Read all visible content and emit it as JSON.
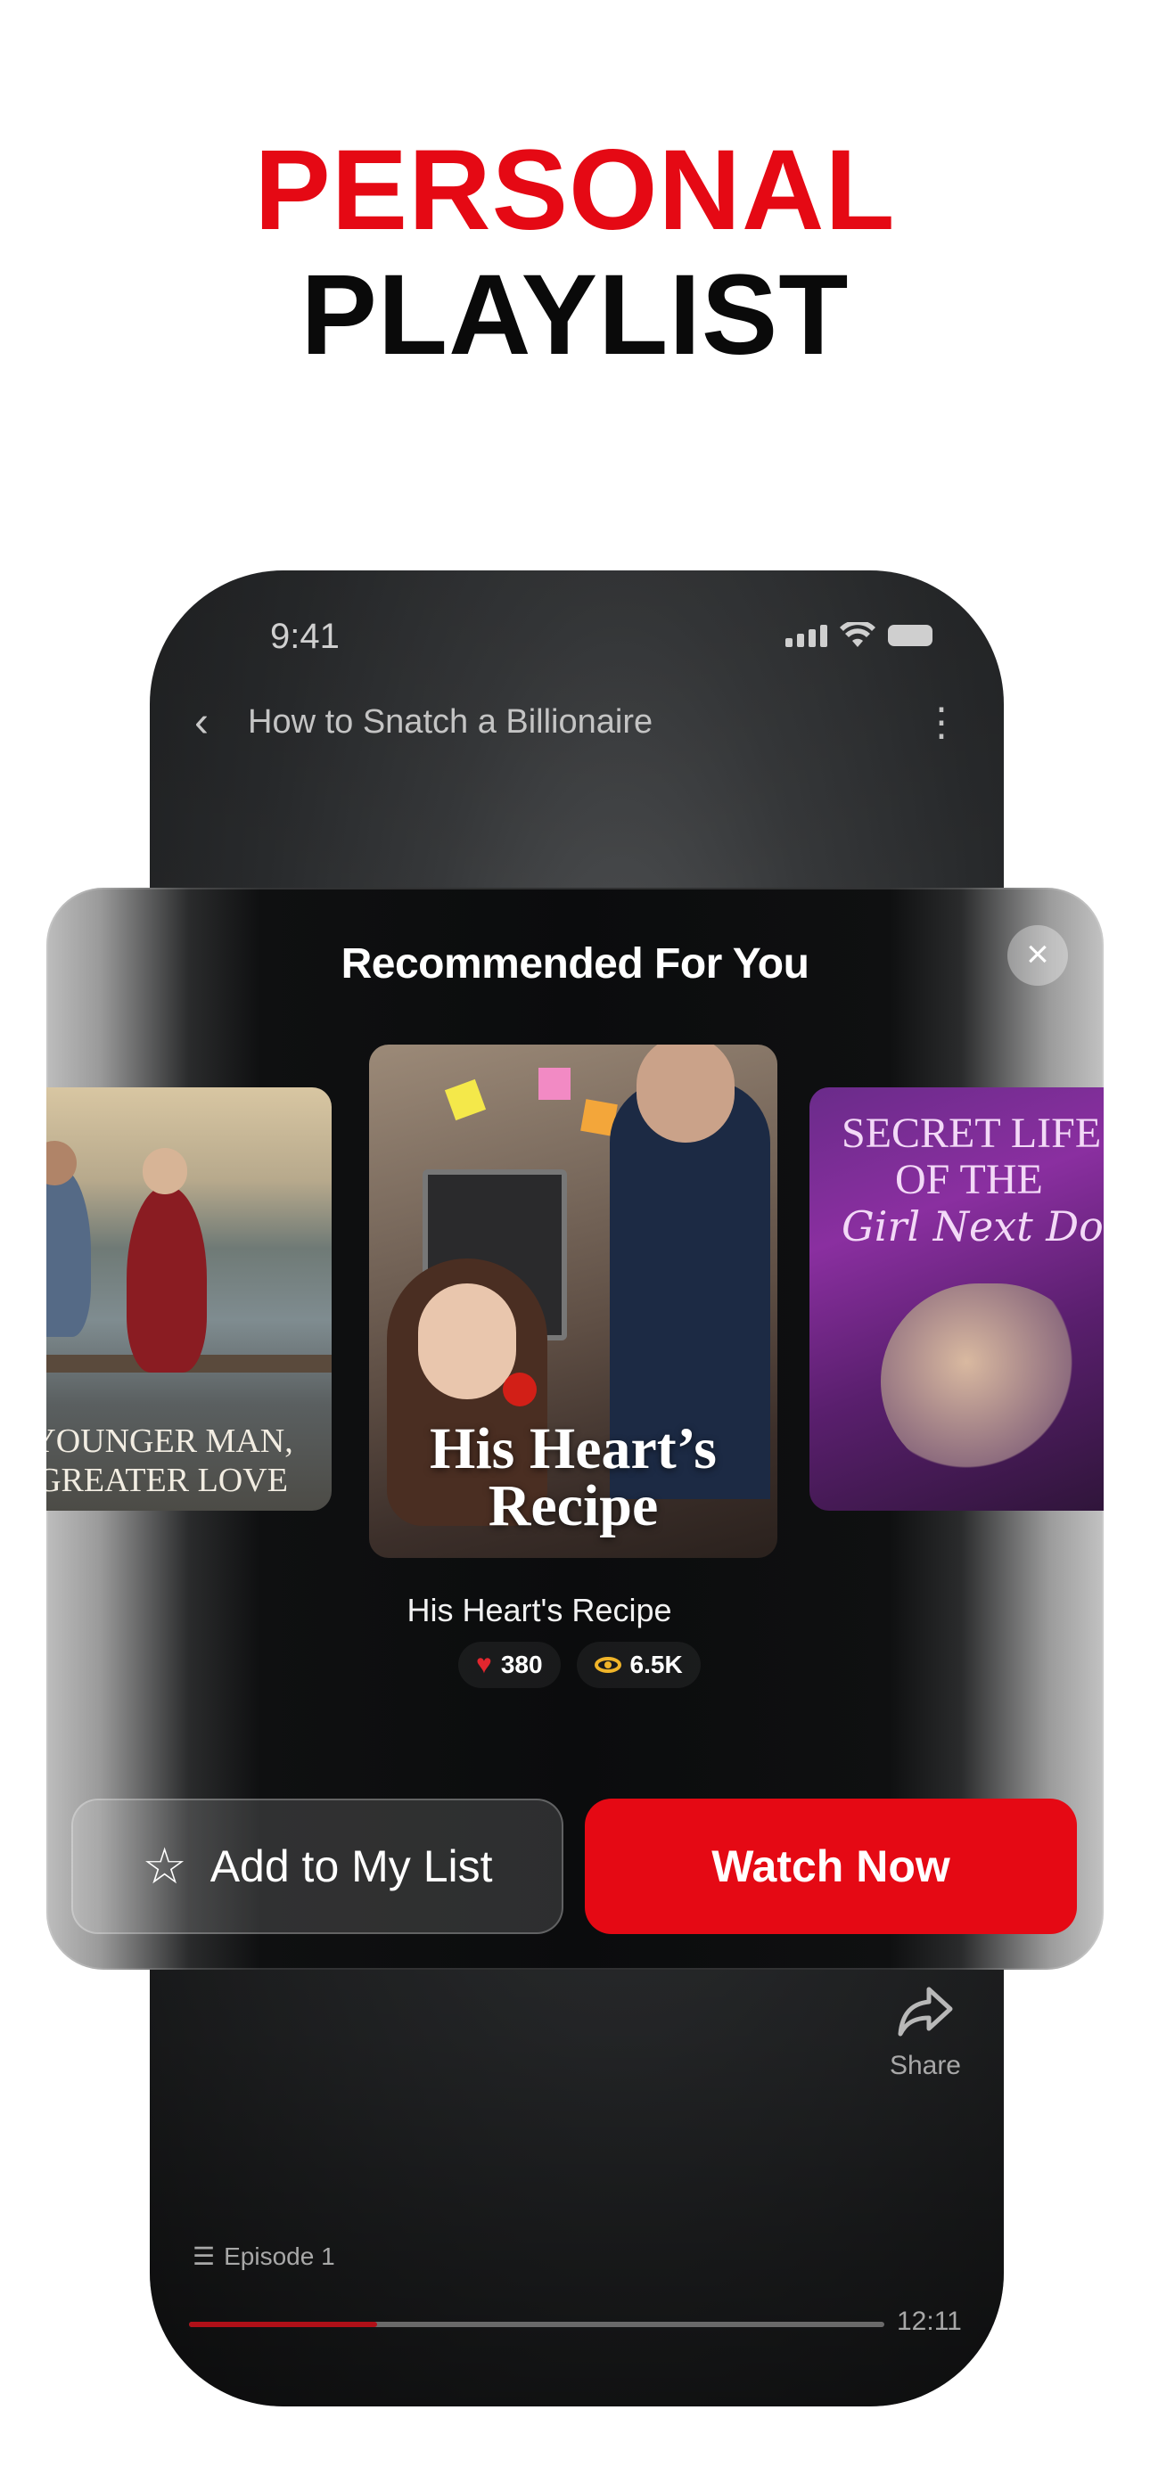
{
  "headline": {
    "line1": "PERSONAL",
    "line2": "PLAYLIST",
    "line1_color": "#e50914",
    "line2_color": "#0a0a0a"
  },
  "status_bar": {
    "time": "9:41"
  },
  "nav": {
    "back_icon": "chevron-left-icon",
    "title": "How to Snatch a Billionaire",
    "more_icon": "more-vertical-icon"
  },
  "player": {
    "share_label": "Share",
    "episode_label": "Episode 1",
    "duration": "12:11",
    "progress": 0.27
  },
  "sheet": {
    "title": "Recommended For You",
    "close_icon": "close-icon",
    "cards": [
      {
        "title_line1": "YOUNGER MAN,",
        "title_line2": "GREATER LOVE"
      },
      {
        "title_line1": "His Heart’s",
        "title_line2": "Recipe"
      },
      {
        "title_line1": "SECRET LIFE",
        "title_line2": "OF THE",
        "title_line3": "Girl Next Door"
      }
    ],
    "selected": {
      "name": "His Heart's Recipe",
      "likes": "380",
      "views": "6.5K"
    },
    "add_button": {
      "label": "Add to My List",
      "icon": "star-icon"
    },
    "watch_button": {
      "label": "Watch Now",
      "color": "#e50914"
    }
  }
}
